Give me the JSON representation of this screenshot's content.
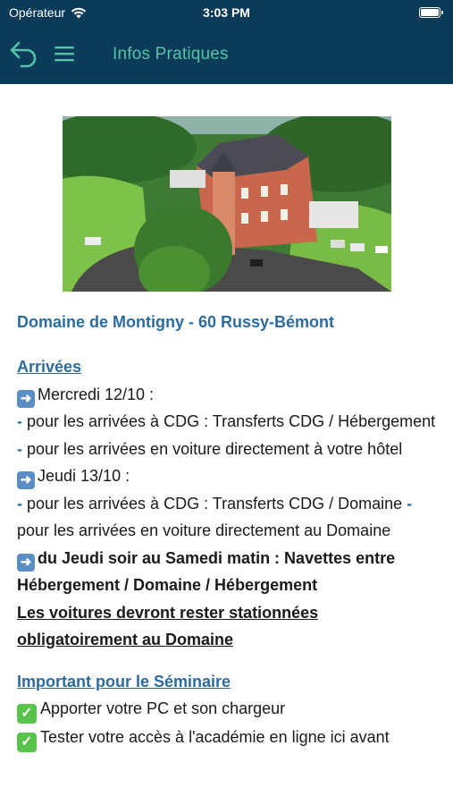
{
  "status_bar": {
    "carrier": "Opérateur",
    "time": "3:03 PM"
  },
  "nav": {
    "title": "Infos Pratiques"
  },
  "venue": {
    "title": "Domaine de Montigny - 60 Russy-Bémont"
  },
  "arrivals": {
    "title": "Arrivées",
    "day1": "Mercredi 12/10 :",
    "day1_line1_dash": "-",
    "day1_line1": " pour les arrivées à CDG : Transferts CDG / Hébergement ",
    "day1_line2_dash": "-",
    "day1_line2": " pour les arrivées en voiture directement à votre hôtel",
    "day2": "Jeudi 13/10 :",
    "day2_line1_dash": "-",
    "day2_line1": " pour les arrivées à CDG : Transferts CDG / Domaine ",
    "day2_line2_dash": "-",
    "day2_line2": " pour les arrivées en voiture directement au Domaine",
    "shuttle": "du Jeudi soir au Samedi matin : Navettes entre Hébergement / Domaine / Hébergement",
    "parking": "Les voitures devront rester stationnées obligatoirement au Domaine"
  },
  "important": {
    "title": "Important pour le Séminaire",
    "item1": "Apporter votre PC et son chargeur",
    "item2": "Tester votre accès à l'académie en ligne ici avant"
  },
  "icons": {
    "arrow": "right-arrow-icon",
    "check": "check-mark-icon"
  },
  "colors": {
    "header_bg": "#0c3b5a",
    "nav_accent": "#55c2a6",
    "link_blue": "#2b6b9e"
  }
}
